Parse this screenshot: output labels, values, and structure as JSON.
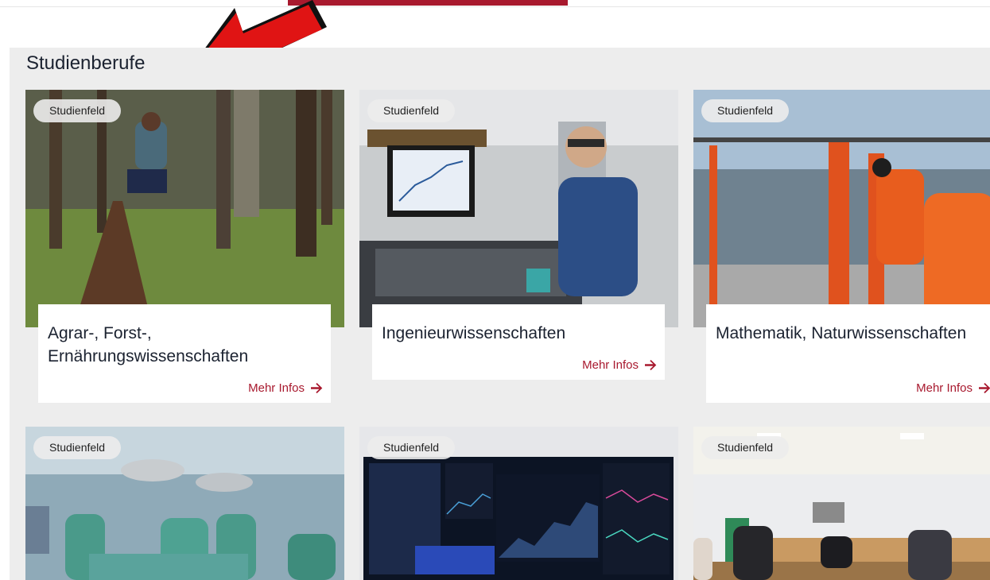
{
  "page": {
    "section_title": "Studienberufe",
    "accent_color": "#a8192e"
  },
  "cards": [
    {
      "badge": "Studienfeld",
      "title": "Agrar-, Forst-, Ernährungswissenschaften",
      "link": "Mehr Infos",
      "image": "forest-measurement-photo"
    },
    {
      "badge": "Studienfeld",
      "title": "Ingenieurwissenschaften",
      "link": "Mehr Infos",
      "image": "laser-lab-photo"
    },
    {
      "badge": "Studienfeld",
      "title": "Mathematik, Naturwissenschaften",
      "link": "Mehr Infos",
      "image": "research-boat-photo"
    },
    {
      "badge": "Studienfeld",
      "image": "operating-room-photo"
    },
    {
      "badge": "Studienfeld",
      "image": "stock-market-screen-photo"
    },
    {
      "badge": "Studienfeld",
      "image": "courtroom-photo"
    }
  ],
  "icons": {
    "arrow": "arrow-right-icon",
    "annotation": "red-annotation-arrow"
  }
}
